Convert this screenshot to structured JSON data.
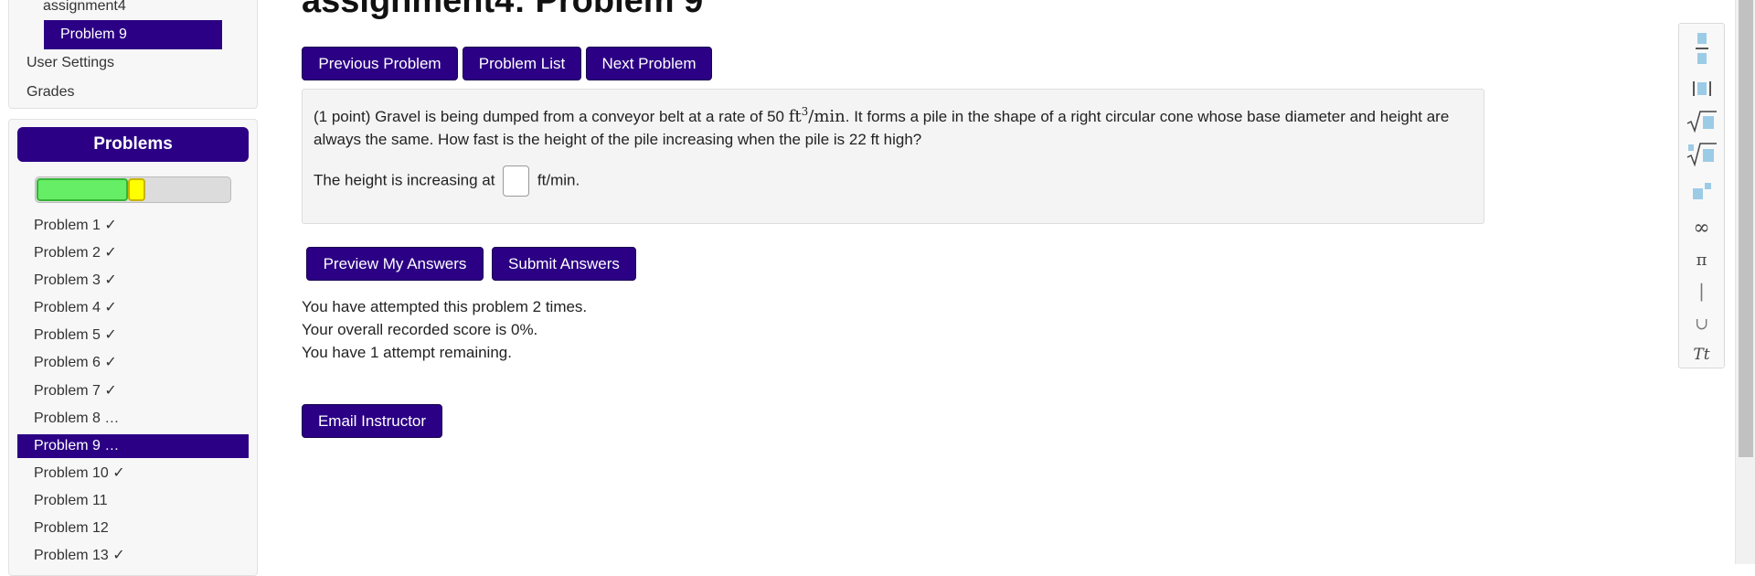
{
  "sidebar": {
    "set_name": "assignment4",
    "current_problem": "Problem 9",
    "links": [
      "User Settings",
      "Grades"
    ],
    "problems_header": "Problems",
    "progress": {
      "correct_fraction": 0.47,
      "partial_fraction": 0.09
    },
    "problems": [
      "Problem 1 ✓",
      "Problem 2 ✓",
      "Problem 3 ✓",
      "Problem 4 ✓",
      "Problem 5 ✓",
      "Problem 6 ✓",
      "Problem 7 ✓",
      "Problem 8 …",
      "Problem 9 …",
      "Problem 10 ✓",
      "Problem 11",
      "Problem 12",
      "Problem 13 ✓"
    ],
    "active_problem_index": 8
  },
  "main": {
    "title": "assignment4: Problem 9",
    "nav_buttons": {
      "previous": "Previous Problem",
      "list": "Problem List",
      "next": "Next Problem"
    },
    "problem": {
      "intro": "(1 point) Gravel is being dumped from a conveyor belt at a rate of 50 ",
      "rate_unit_base": "ft",
      "rate_unit_exp": "3",
      "rate_unit_rest": "/min",
      "rest": ". It forms a pile in the shape of a right circular cone whose base diameter and height are always the same. How fast is the height of the pile increasing when the pile is 22 ft high?",
      "answer_prefix": "The height is increasing at",
      "answer_value": "",
      "answer_suffix": "ft/min."
    },
    "actions": {
      "preview": "Preview My Answers",
      "submit": "Submit Answers"
    },
    "status": [
      "You have attempted this problem 2 times.",
      "Your overall recorded score is 0%.",
      "You have 1 attempt remaining."
    ],
    "email_button": "Email Instructor"
  },
  "toolbar": {
    "tools": [
      "fraction-icon",
      "mixed-fraction-icon",
      "sqrt-icon",
      "nth-root-icon",
      "exponent-icon",
      "infinity-icon",
      "pi-icon",
      "vertical-bar-icon",
      "union-icon",
      "text-mode-icon"
    ],
    "symbols": {
      "infinity": "∞",
      "pi": "π",
      "bar": "|",
      "union": "∪",
      "text": "Tt"
    }
  },
  "colors": {
    "accent": "#2b0085",
    "correct": "#66ee66",
    "partial": "#ffff00",
    "icon_blue": "#9ccbe6"
  }
}
